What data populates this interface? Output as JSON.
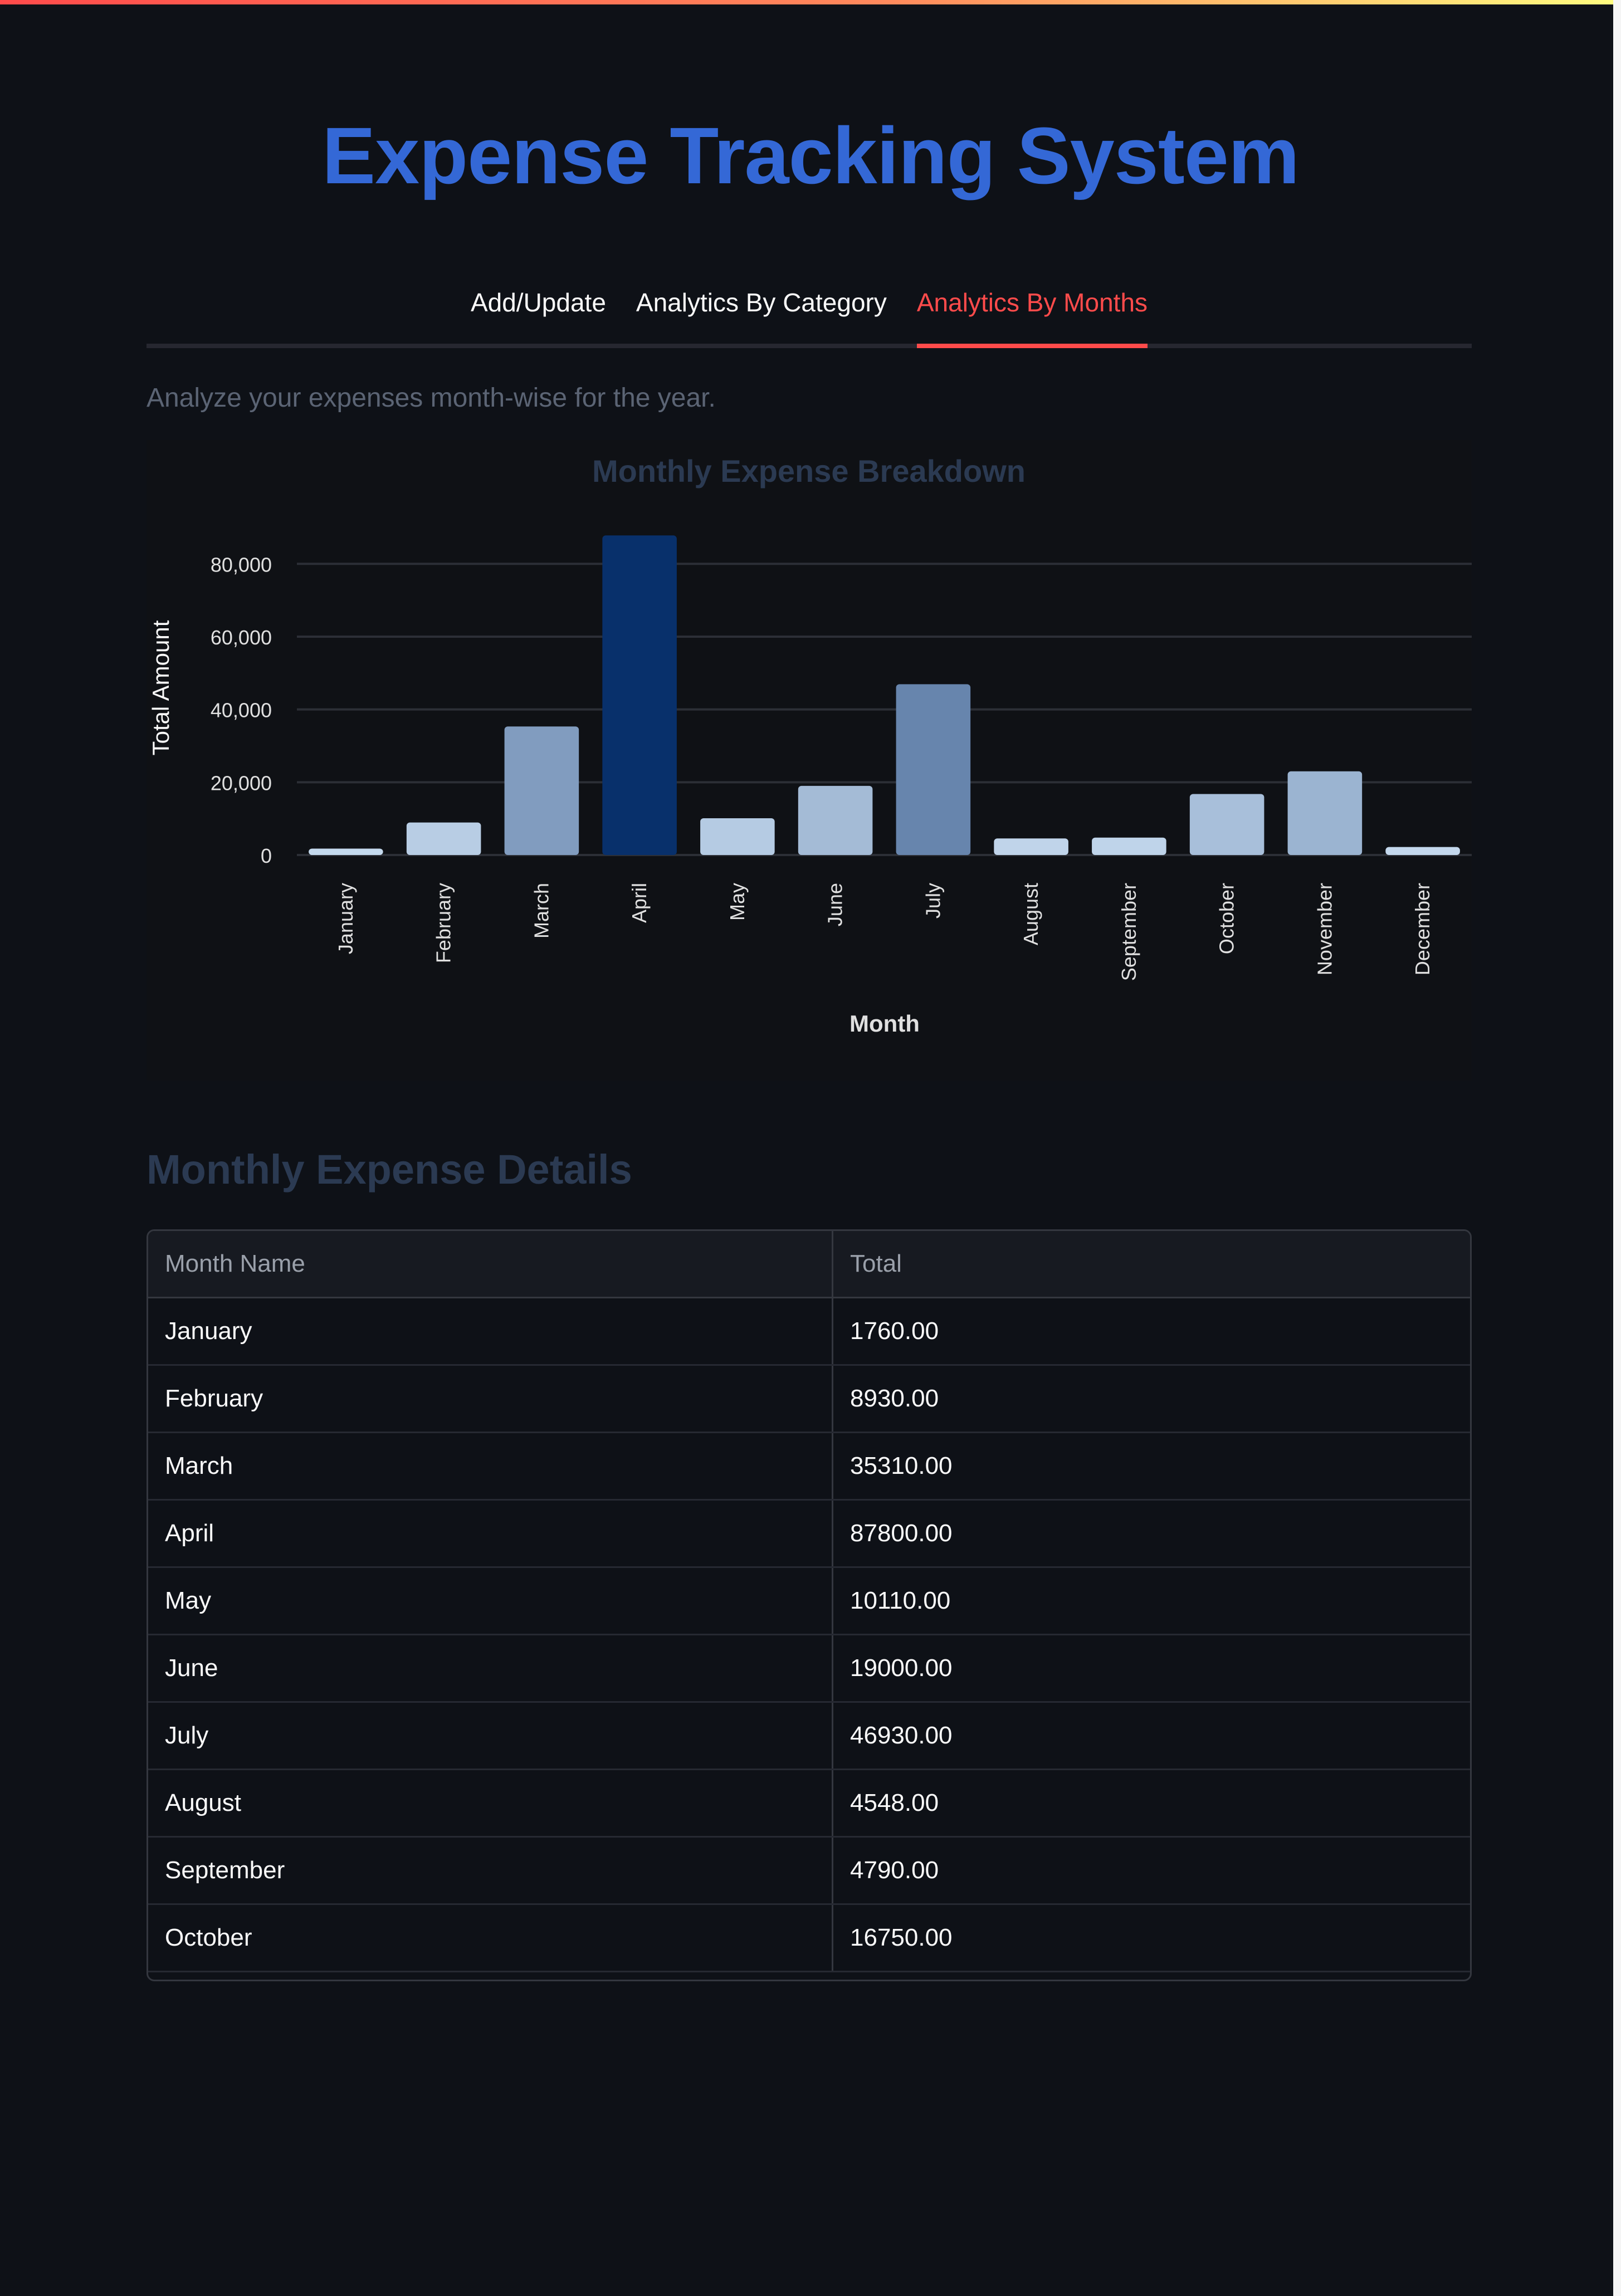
{
  "header": {
    "title": "Expense Tracking System"
  },
  "tabs": [
    {
      "label": "Add/Update",
      "active": false
    },
    {
      "label": "Analytics By Category",
      "active": false
    },
    {
      "label": "Analytics By Months",
      "active": true
    }
  ],
  "caption": "Analyze your expenses month-wise for the year.",
  "chart_data": {
    "type": "bar",
    "title": "Monthly Expense Breakdown",
    "xlabel": "Month",
    "ylabel": "Total Amount",
    "categories": [
      "January",
      "February",
      "March",
      "April",
      "May",
      "June",
      "July",
      "August",
      "September",
      "October",
      "November",
      "December"
    ],
    "values": [
      1760,
      8930,
      35310,
      87800,
      10110,
      19000,
      46930,
      4548,
      4790,
      16750,
      23000,
      2200
    ],
    "ylim": [
      0,
      88000
    ],
    "yticks": [
      0,
      20000,
      40000,
      60000,
      80000
    ],
    "ytick_labels": [
      "0",
      "20,000",
      "40,000",
      "60,000",
      "80,000"
    ],
    "grid": true,
    "color_scale": [
      "#c7dbef",
      "#08306b"
    ]
  },
  "table": {
    "title": "Monthly Expense Details",
    "columns": [
      "Month Name",
      "Total"
    ],
    "rows": [
      [
        "January",
        "1760.00"
      ],
      [
        "February",
        "8930.00"
      ],
      [
        "March",
        "35310.00"
      ],
      [
        "April",
        "87800.00"
      ],
      [
        "May",
        "10110.00"
      ],
      [
        "June",
        "19000.00"
      ],
      [
        "July",
        "46930.00"
      ],
      [
        "August",
        "4548.00"
      ],
      [
        "September",
        "4790.00"
      ],
      [
        "October",
        "16750.00"
      ]
    ]
  }
}
